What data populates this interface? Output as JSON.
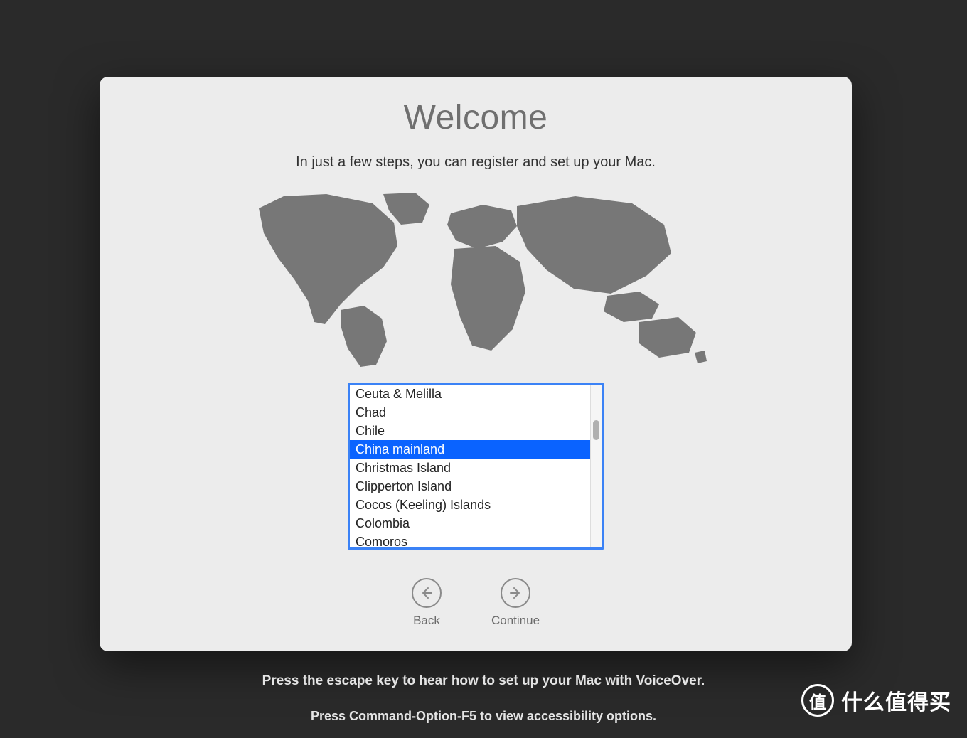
{
  "window": {
    "title": "Welcome",
    "subtitle": "In just a few steps, you can register and set up your Mac."
  },
  "countries": {
    "items": [
      "Ceuta & Melilla",
      "Chad",
      "Chile",
      "China mainland",
      "Christmas Island",
      "Clipperton Island",
      "Cocos (Keeling) Islands",
      "Colombia",
      "Comoros"
    ],
    "selected_index": 3
  },
  "nav": {
    "back": "Back",
    "continue": "Continue"
  },
  "footer": {
    "line1": "Press the escape key to hear how to set up your Mac with VoiceOver.",
    "line2": "Press Command-Option-F5 to view accessibility options."
  },
  "watermark": {
    "badge": "值",
    "text": "什么值得买"
  }
}
